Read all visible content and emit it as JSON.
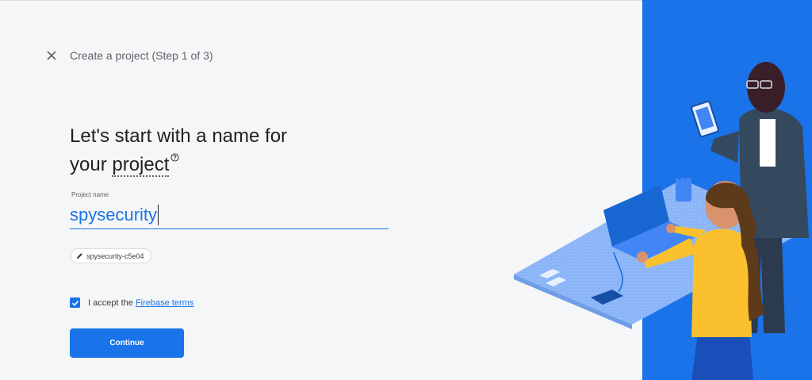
{
  "header": {
    "close_icon": "close-icon",
    "title": "Create a project (Step 1 of 3)"
  },
  "main": {
    "heading_line1": "Let's start with a name for",
    "heading_your": "your",
    "heading_project": "project",
    "help_icon": "help-circle-icon",
    "field_label": "Project name",
    "field_value": "spysecurity",
    "project_id_chip": "spysecurity-c5e04",
    "chip_icon": "pencil-icon",
    "checkbox_checked": true,
    "accept_text": "I accept the ",
    "accept_link": "Firebase terms",
    "continue_label": "Continue"
  },
  "colors": {
    "accent": "#1a73e8",
    "panel_blue": "#1a73e8",
    "background": "#f5f6f7"
  }
}
